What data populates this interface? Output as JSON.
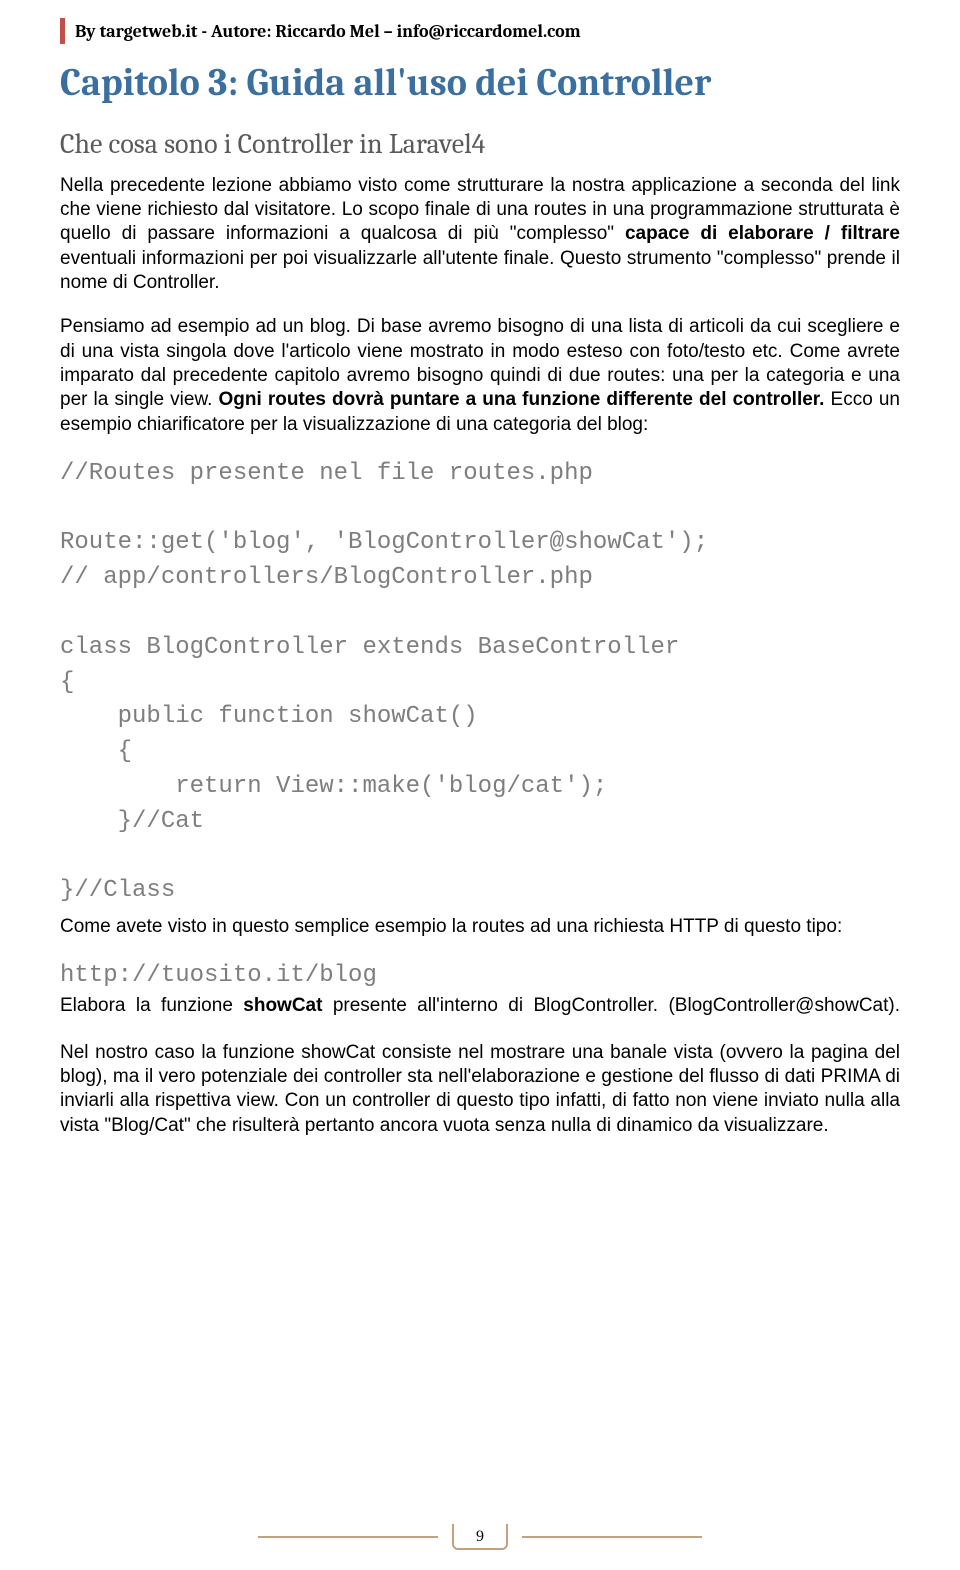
{
  "header": {
    "text": "By targetweb.it - Autore: Riccardo Mel – info@riccardomel.com"
  },
  "title": "Capitolo 3: Guida all'uso dei Controller",
  "subtitle": "Che cosa sono  i Controller in Laravel4",
  "p1_a": "Nella precedente lezione abbiamo visto come strutturare la nostra applicazione a seconda del link che viene richiesto dal visitatore. Lo scopo finale di una routes in una programmazione strutturata è quello di passare informazioni a qualcosa di più \"complesso\" ",
  "p1_bold1": "capace di elaborare / filtrare",
  "p1_b": " eventuali informazioni per poi visualizzarle all'utente finale. Questo strumento \"complesso\" prende il nome di Controller.",
  "p2_a": "Pensiamo ad esempio ad un blog. Di base avremo bisogno di una lista di articoli da cui scegliere e di una vista singola dove l'articolo viene mostrato in modo esteso con foto/testo etc. Come avrete imparato dal precedente capitolo avremo bisogno quindi di due routes: una per la categoria e una per la single view. ",
  "p2_bold": "Ogni routes dovrà puntare a una funzione differente del controller.",
  "p2_b": " Ecco un esempio chiarificatore per la visualizzazione di una categoria del blog:",
  "code": "//Routes presente nel file routes.php\n\nRoute::get('blog', 'BlogController@showCat');\n// app/controllers/BlogController.php\n\nclass BlogController extends BaseController\n{\n    public function showCat()\n    {\n        return View::make('blog/cat');\n    }//Cat\n\n}//Class",
  "p3": "Come avete visto in questo semplice esempio la routes ad una richiesta HTTP di questo tipo:",
  "code2": "http://tuosito.it/blog",
  "p4_a": "Elabora la funzione ",
  "p4_bold": "showCat",
  "p4_b": " presente all'interno di BlogController. (BlogController@showCat).",
  "p5": "Nel nostro caso la funzione showCat consiste nel mostrare una banale vista (ovvero la pagina del blog), ma il vero potenziale dei controller sta nell'elaborazione e gestione del flusso di dati PRIMA di inviarli alla rispettiva view. Con un controller di questo tipo infatti, di fatto non viene inviato nulla alla vista \"Blog/Cat\" che risulterà pertanto ancora vuota senza nulla di dinamico da visualizzare.",
  "page_number": "9"
}
